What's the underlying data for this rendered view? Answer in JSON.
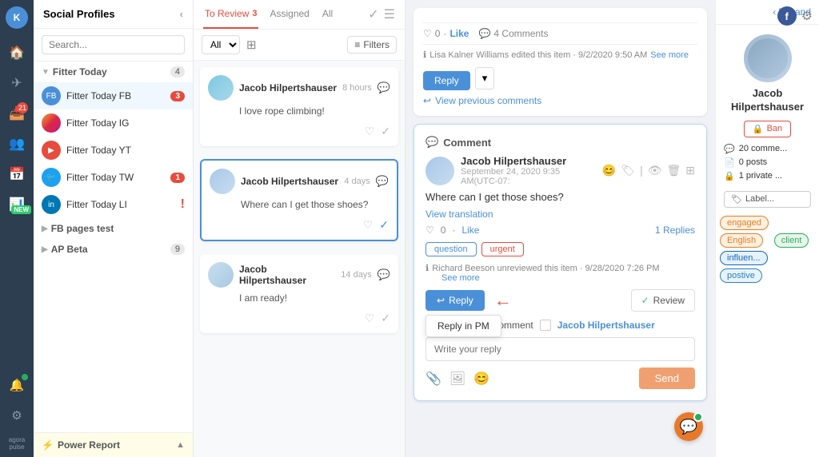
{
  "app": {
    "title": "Social Profiles",
    "topbar": {
      "expand_label": "Expand",
      "fb_icon": "f",
      "gear_icon": "⚙"
    }
  },
  "sidebar": {
    "user_initial": "K",
    "nav_items": [
      {
        "name": "home",
        "icon": "🏠"
      },
      {
        "name": "paper-plane",
        "icon": "✈"
      },
      {
        "name": "inbox",
        "icon": "📥",
        "badge": "21"
      },
      {
        "name": "users",
        "icon": "👥"
      },
      {
        "name": "calendar",
        "icon": "📅"
      },
      {
        "name": "chart",
        "icon": "📊",
        "badge_new": "NEW"
      }
    ],
    "bottom_items": [
      {
        "name": "notification",
        "icon": "🔔"
      },
      {
        "name": "info",
        "icon": "ℹ"
      }
    ],
    "brand": "agora\npulse"
  },
  "social_panel": {
    "title": "Social Profiles",
    "search_placeholder": "Search...",
    "sections": [
      {
        "name": "Fitter Today",
        "count": 4,
        "profiles": [
          {
            "name": "Fitter Today FB",
            "badge": "3",
            "badge_type": "red"
          },
          {
            "name": "Fitter Today IG",
            "badge": null
          },
          {
            "name": "Fitter Today YT",
            "badge": null
          },
          {
            "name": "Fitter Today TW",
            "badge": "1",
            "badge_type": "red"
          },
          {
            "name": "Fitter Today LI",
            "badge": "!",
            "badge_type": "orange"
          }
        ]
      },
      {
        "name": "FB pages test",
        "count": null
      },
      {
        "name": "AP Beta",
        "count": 9
      }
    ],
    "footer": {
      "icon": "⚡",
      "label": "Power Report",
      "chevron": "▲"
    }
  },
  "middle_panel": {
    "tabs": [
      {
        "label": "To Review",
        "count": 3,
        "active": true
      },
      {
        "label": "Assigned",
        "count": null,
        "active": false
      },
      {
        "label": "All",
        "count": null,
        "active": false
      }
    ],
    "filter_all": "All",
    "filter_btn": "Filters",
    "messages": [
      {
        "name": "Jacob Hilpertshauser",
        "time": "8 hours",
        "text": "I love rope climbing!",
        "active": false
      },
      {
        "name": "Jacob Hilpertshauser",
        "time": "4 days",
        "text": "Where can I get those shoes?",
        "active": true
      },
      {
        "name": "Jacob Hilpertshauser",
        "time": "14 days",
        "text": "I am ready!",
        "active": false
      }
    ]
  },
  "main": {
    "post": {
      "like_count": "0",
      "like_label": "Like",
      "comment_count": "4 Comments",
      "activity": "Lisa Kalner Williams edited this item · 9/2/2020 9:50 AM",
      "see_more": "See more",
      "reply_btn": "Reply",
      "view_previous": "View previous comments"
    },
    "comment": {
      "section_label": "Comment",
      "author": "Jacob Hilpertshauser",
      "date": "September 24, 2020 9:35 AM(UTC-07:",
      "text": "Where can I get those shoes?",
      "translate": "View translation",
      "like_count": "0",
      "like_label": "Like",
      "replies_count": "1 Replies",
      "tags": [
        "question",
        "urgent"
      ],
      "activity": "Richard Beeson unreviewed this item · 9/28/2020 7:26 PM",
      "see_more": "See more",
      "reply_btn": "Reply",
      "reply_in_pm": "Reply in PM",
      "review_btn": "Review",
      "mention_label": "Mention in your comment",
      "mention_name": "Jacob Hilpertshauser",
      "reply_placeholder": "Write your reply",
      "send_btn": "Send"
    }
  },
  "right_panel": {
    "expand": "Expand",
    "user": {
      "name": "Jacob Hilpertshauser",
      "ban_btn": "Ban",
      "stats": [
        {
          "icon": "💬",
          "value": "20 comme..."
        },
        {
          "icon": "📄",
          "value": "0 posts"
        },
        {
          "icon": "🔒",
          "value": "1 private ..."
        }
      ],
      "label_btn": "Label...",
      "labels": [
        {
          "name": "engaged",
          "class": "engaged"
        },
        {
          "name": "English",
          "class": "english"
        },
        {
          "name": "client",
          "class": "client"
        },
        {
          "name": "influen...",
          "class": "influen"
        },
        {
          "name": "postive",
          "class": "positive"
        }
      ]
    }
  }
}
